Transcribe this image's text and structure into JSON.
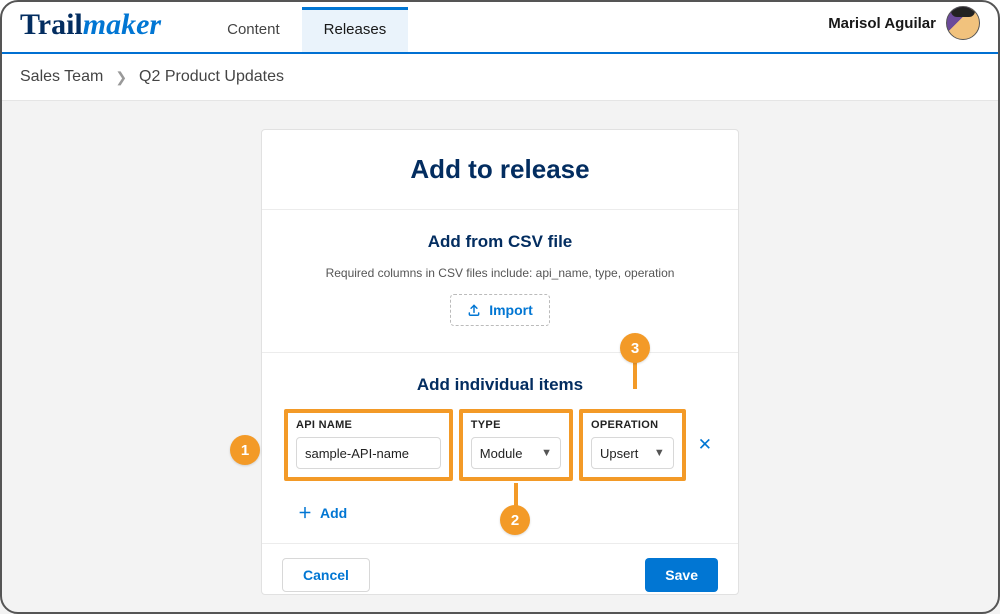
{
  "brand": {
    "part1": "Trail",
    "part2": "maker"
  },
  "nav": {
    "tabs": [
      {
        "label": "Content",
        "active": false
      },
      {
        "label": "Releases",
        "active": true
      }
    ]
  },
  "user": {
    "name": "Marisol Aguilar"
  },
  "breadcrumb": {
    "root": "Sales Team",
    "current": "Q2 Product Updates"
  },
  "card": {
    "title": "Add to release",
    "csv": {
      "heading": "Add from CSV file",
      "hint": "Required columns in CSV files include: api_name, type, operation",
      "import_label": "Import"
    },
    "individual": {
      "heading": "Add individual items",
      "fields": {
        "api_name": {
          "label": "API NAME",
          "value": "sample-API-name"
        },
        "type": {
          "label": "TYPE",
          "value": "Module"
        },
        "operation": {
          "label": "OPERATION",
          "value": "Upsert"
        }
      },
      "add_label": "Add"
    },
    "footer": {
      "cancel": "Cancel",
      "save": "Save"
    }
  },
  "callouts": [
    "1",
    "2",
    "3"
  ]
}
